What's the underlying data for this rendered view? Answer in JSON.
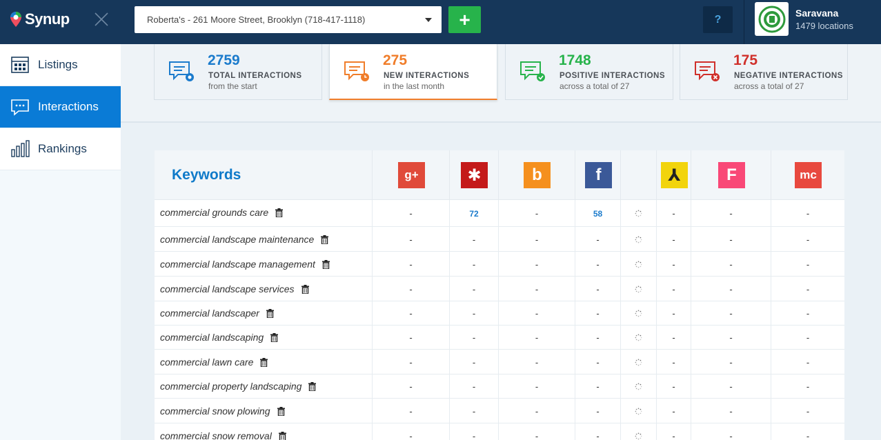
{
  "app": {
    "brand": "Synup"
  },
  "header": {
    "location_select": "Roberta's - 261 Moore Street, Brooklyn (718-417-1118)",
    "add_label": "+",
    "help_label": "?",
    "user": {
      "name": "Saravana",
      "locations": "1479 locations"
    }
  },
  "sidebar": {
    "items": [
      {
        "label": "Listings",
        "icon": "listings-grid-icon",
        "active": false
      },
      {
        "label": "Interactions",
        "icon": "chat-bubble-icon",
        "active": true
      },
      {
        "label": "Rankings",
        "icon": "bar-chart-icon",
        "active": false
      }
    ]
  },
  "stats": [
    {
      "value": "2759",
      "label": "TOTAL INTERACTIONS",
      "sub": "from the start",
      "color": "#1b7bcc"
    },
    {
      "value": "275",
      "label": "NEW INTERACTIONS",
      "sub": "in the last month",
      "color": "#f07d2a"
    },
    {
      "value": "1748",
      "label": "POSITIVE INTERACTIONS",
      "sub": "across a total of 27",
      "color": "#27b34b"
    },
    {
      "value": "175",
      "label": "NEGATIVE INTERACTIONS",
      "sub": "across a total of 27",
      "color": "#d0302b"
    }
  ],
  "table": {
    "title": "Keywords",
    "sources": [
      {
        "icon": "google-plus-icon",
        "glyph": "g+",
        "color": "#e04a3a"
      },
      {
        "icon": "yelp-icon",
        "glyph": "✱",
        "color": "#c41a1a"
      },
      {
        "icon": "bing-icon",
        "glyph": "b",
        "color": "#f5901e"
      },
      {
        "icon": "facebook-icon",
        "glyph": "f",
        "color": "#3b5998"
      },
      {
        "icon": "blank-source-icon",
        "glyph": "",
        "color": ""
      },
      {
        "icon": "yellowpages-icon",
        "glyph": "⅄",
        "color": "#f2d40c"
      },
      {
        "icon": "foursquare-icon",
        "glyph": "F",
        "color": "#f94877"
      },
      {
        "icon": "merchantcircle-icon",
        "glyph": "mc",
        "color": "#e8493f"
      }
    ],
    "rows": [
      {
        "keyword": "commercial grounds care",
        "values": [
          "-",
          "72",
          "-",
          "58",
          "",
          "-",
          "-",
          "-"
        ]
      },
      {
        "keyword": "commercial landscape maintenance",
        "values": [
          "-",
          "-",
          "-",
          "-",
          "",
          "-",
          "-",
          "-"
        ]
      },
      {
        "keyword": "commercial landscape management",
        "values": [
          "-",
          "-",
          "-",
          "-",
          "",
          "-",
          "-",
          "-"
        ]
      },
      {
        "keyword": "commercial landscape services",
        "values": [
          "-",
          "-",
          "-",
          "-",
          "",
          "-",
          "-",
          "-"
        ]
      },
      {
        "keyword": "commercial landscaper",
        "values": [
          "-",
          "-",
          "-",
          "-",
          "",
          "-",
          "-",
          "-"
        ]
      },
      {
        "keyword": "commercial landscaping",
        "values": [
          "-",
          "-",
          "-",
          "-",
          "",
          "-",
          "-",
          "-"
        ]
      },
      {
        "keyword": "commercial lawn care",
        "values": [
          "-",
          "-",
          "-",
          "-",
          "",
          "-",
          "-",
          "-"
        ]
      },
      {
        "keyword": "commercial property landscaping",
        "values": [
          "-",
          "-",
          "-",
          "-",
          "",
          "-",
          "-",
          "-"
        ]
      },
      {
        "keyword": "commercial snow plowing",
        "values": [
          "-",
          "-",
          "-",
          "-",
          "",
          "-",
          "-",
          "-"
        ]
      },
      {
        "keyword": "commercial snow removal",
        "values": [
          "-",
          "-",
          "-",
          "-",
          "",
          "-",
          "-",
          "-"
        ]
      }
    ]
  }
}
